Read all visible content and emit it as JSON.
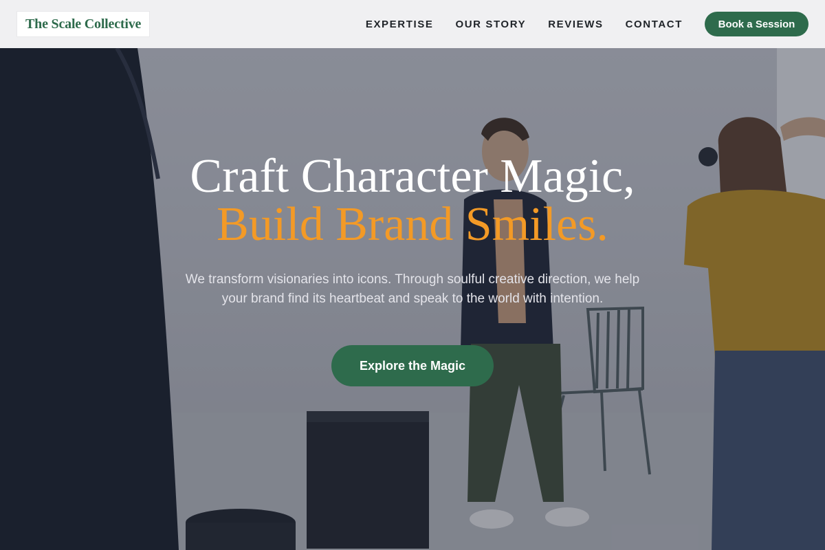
{
  "header": {
    "logo_text": "The Scale Collective",
    "nav": [
      {
        "label": "EXPERTISE"
      },
      {
        "label": "OUR STORY"
      },
      {
        "label": "REVIEWS"
      },
      {
        "label": "CONTACT"
      }
    ],
    "cta_label": "Book a Session"
  },
  "hero": {
    "headline_line1": "Craft Character Magic,",
    "headline_line2": "Build Brand Smiles.",
    "subtext": "We transform visionaries into icons. Through soulful creative direction, we help your brand find its heartbeat and speak to the world with intention.",
    "cta_label": "Explore the Magic",
    "background_description_icon": "photo-studio-background"
  },
  "colors": {
    "brand_green": "#2e6b4c",
    "accent_orange": "#f39a26",
    "header_bg": "#f4f4f5"
  }
}
